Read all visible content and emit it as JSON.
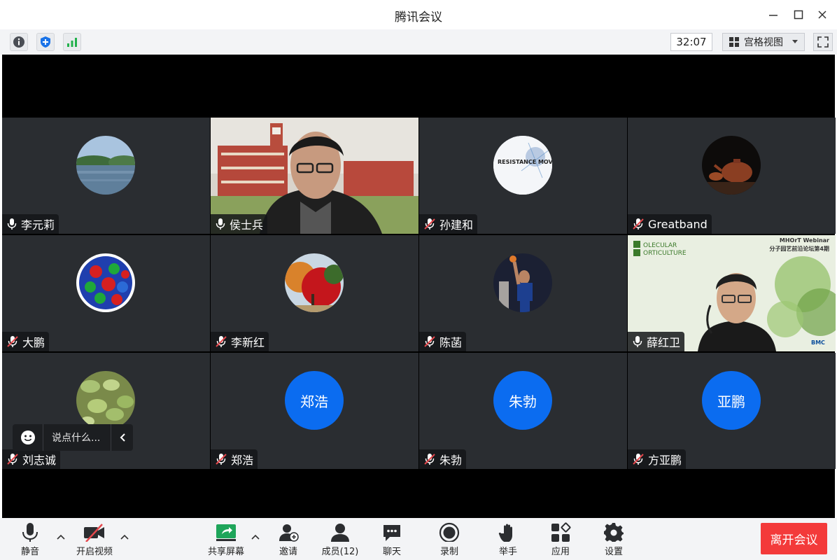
{
  "window": {
    "title": "腾讯会议"
  },
  "toolbar": {
    "timer": "32:07",
    "view_label": "宫格视图"
  },
  "participants": [
    {
      "name": "李元莉",
      "mic": "on",
      "avatar": "lake-photo"
    },
    {
      "name": "侯士兵",
      "mic": "on",
      "avatar": "video-man-campus",
      "speaking": true
    },
    {
      "name": "孙建和",
      "mic": "muted",
      "avatar": "resistance-movement-graphic"
    },
    {
      "name": "Greatband",
      "mic": "muted",
      "avatar": "teapot-photo"
    },
    {
      "name": "大鹏",
      "mic": "muted",
      "avatar": "molecule-model"
    },
    {
      "name": "李新红",
      "mic": "muted",
      "avatar": "autumn-tree-photo"
    },
    {
      "name": "陈菡",
      "mic": "muted",
      "avatar": "basketball-player-photo"
    },
    {
      "name": "薛红卫",
      "mic": "on",
      "avatar": "video-man-webinar"
    },
    {
      "name": "刘志诚",
      "mic": "muted",
      "avatar": "succulent-plant-photo"
    },
    {
      "name": "郑浩",
      "mic": "muted",
      "avatar_text": "郑浩"
    },
    {
      "name": "朱勃",
      "mic": "muted",
      "avatar_text": "朱勃"
    },
    {
      "name": "方亚鹏",
      "mic": "muted",
      "avatar_text": "亚鹏"
    }
  ],
  "tile_texts": {
    "resistance": "RESISTANCE MOVEMENT",
    "webinar_title": "MHOrT Webinar",
    "webinar_subtitle": "分子园艺前沿论坛第4期",
    "webinar_logo_line1": "OLECULAR",
    "webinar_logo_line2": "ORTICULTURE",
    "bmc": "BMC"
  },
  "chat": {
    "placeholder": "说点什么..."
  },
  "controls": {
    "mute": "静音",
    "video": "开启视频",
    "share": "共享屏幕",
    "invite": "邀请",
    "members": "成员(12)",
    "chat": "聊天",
    "record": "录制",
    "raise_hand": "举手",
    "apps": "应用",
    "settings": "设置",
    "leave": "离开会议"
  },
  "colors": {
    "accent_blue": "#0b6cf0",
    "leave_red": "#f33a3a",
    "speaking_green": "#1ec15f",
    "muted_red": "#e5484d"
  }
}
